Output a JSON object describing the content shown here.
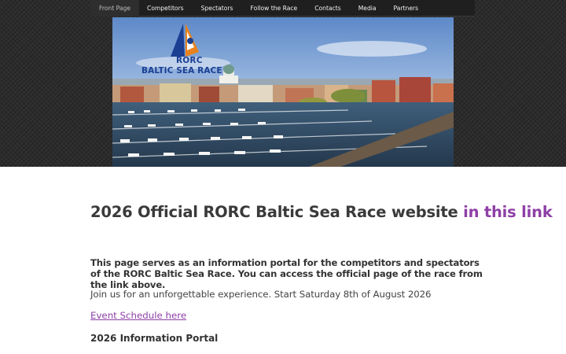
{
  "nav": {
    "items": [
      {
        "label": "Front Page",
        "active": true
      },
      {
        "label": "Competitors"
      },
      {
        "label": "Spectators"
      },
      {
        "label": "Follow the Race"
      },
      {
        "label": "Contacts"
      },
      {
        "label": "Media"
      },
      {
        "label": "Partners"
      }
    ]
  },
  "hero": {
    "logo_line1": "RORC",
    "logo_line2": "BALTIC SEA RACE",
    "logo_icon": "sail-crest-logo"
  },
  "main": {
    "headline_text": "2026 Official RORC Baltic Sea Race website ",
    "headline_link": "in this link",
    "intro": "This page serves as an information portal for the competitors and spectators of the RORC Baltic Sea Race. You can access the official page of the race from the link above.",
    "join": "Join us for an unforgettable experience. Start Saturday 8th of August 2026",
    "schedule_link": "Event Schedule here",
    "portal_heading": "2026 Information Portal"
  },
  "colors": {
    "link": "#8e3fa6",
    "nav_bg": "#1f1f1f",
    "logo_blue": "#1b3f93",
    "logo_orange": "#e8821c"
  }
}
